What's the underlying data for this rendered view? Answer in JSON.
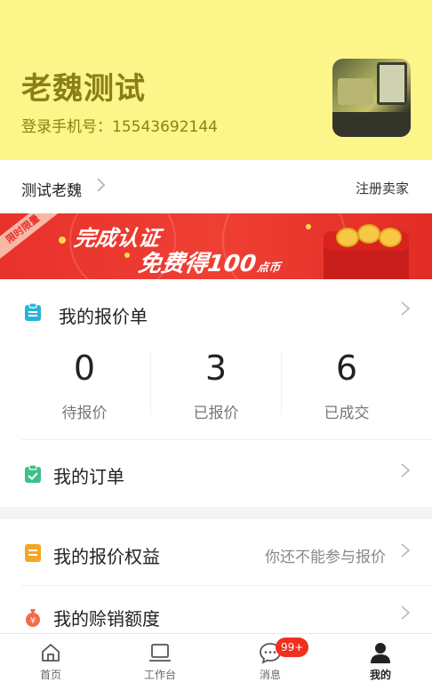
{
  "profile": {
    "name": "老魏测试",
    "phone_label": "登录手机号：",
    "phone": "15543692144"
  },
  "store": {
    "name": "测试老魏",
    "register_label": "注册卖家"
  },
  "banner": {
    "ribbon": "限时限量",
    "line1": "完成认证",
    "line2": "免费得100",
    "line2_unit": "点币"
  },
  "quote_list": {
    "title": "我的报价单",
    "stats": [
      {
        "value": "0",
        "label": "待报价"
      },
      {
        "value": "3",
        "label": "已报价"
      },
      {
        "value": "6",
        "label": "已成交"
      }
    ]
  },
  "orders": {
    "title": "我的订单"
  },
  "benefits": {
    "title": "我的报价权益",
    "note": "你还不能参与报价"
  },
  "credit": {
    "title": "我的赊销额度"
  },
  "tabbar": {
    "items": [
      {
        "label": "首页",
        "icon": "home-icon"
      },
      {
        "label": "工作台",
        "icon": "laptop-icon"
      },
      {
        "label": "消息",
        "icon": "chat-icon",
        "badge": "99+"
      },
      {
        "label": "我的",
        "icon": "person-icon",
        "active": true
      }
    ]
  },
  "colors": {
    "header_bg": "#fbf58a",
    "name_color": "#8a7f15",
    "banner_red": "#e8322c",
    "badge_red": "#f0301f",
    "icon_teal": "#2bb3d6",
    "icon_green": "#3fbf8a",
    "icon_orange": "#f5a623",
    "icon_red_orange": "#f26b4a"
  }
}
